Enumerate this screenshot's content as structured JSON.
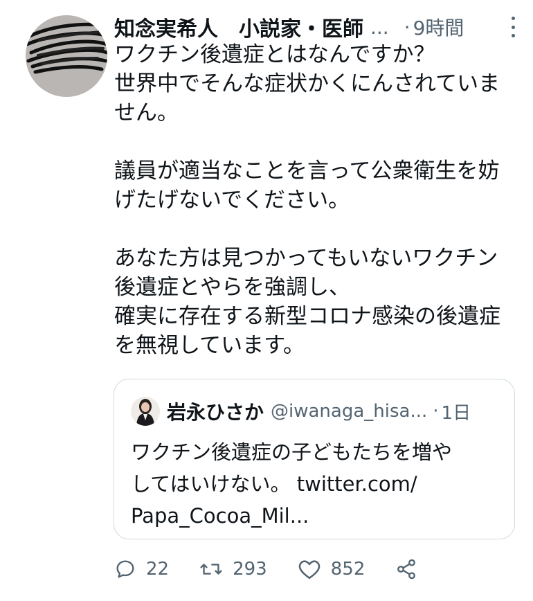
{
  "tweet": {
    "author_name": "知念実希人　小説家・医師",
    "ellipsis": "...",
    "separator": "·",
    "time": "9時間",
    "body_lines": [
      "ワクチン後遺症とはなんですか？",
      "世界中でそんな症状かくにんされていま",
      "せん。",
      "",
      "議員が適当なことを言って公衆衛生を妨",
      "げたげないでください。",
      "",
      "あなた方は見つかってもいないワクチン",
      "後遺症とやらを強調し、",
      "確実に存在する新型コロナ感染の後遺症",
      "を無視しています。"
    ]
  },
  "quote": {
    "name": "岩永ひさか",
    "handle": "@iwanaga_hisa...",
    "separator": "·",
    "time": "1日",
    "text_lines": [
      "ワクチン後遺症の子どもたちを増や",
      "してはいけない。 twitter.com/",
      "Papa_Cocoa_Mil..."
    ]
  },
  "actions": {
    "reply_count": "22",
    "retweet_count": "293",
    "like_count": "852"
  },
  "icons": {
    "reply": "reply-icon",
    "retweet": "retweet-icon",
    "like": "heart-icon",
    "share": "share-icon",
    "more": "more-icon"
  },
  "colors": {
    "text": "#0f1419",
    "secondary": "#536471",
    "border": "#cfd9de"
  }
}
